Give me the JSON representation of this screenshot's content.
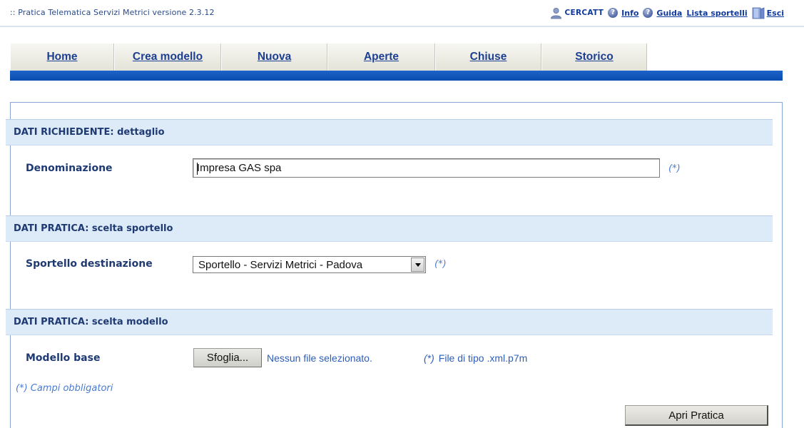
{
  "app": {
    "title": ":: Pratica Telematica Servizi Metrici versione 2.3.12"
  },
  "top_links": {
    "user": "CERCATT",
    "info": "Info",
    "guide": "Guida",
    "offices": "Lista sportelli",
    "exit": "Esci"
  },
  "tabs": [
    {
      "label": "Home"
    },
    {
      "label": "Crea modello"
    },
    {
      "label": "Nuova"
    },
    {
      "label": "Aperte"
    },
    {
      "label": "Chiuse"
    },
    {
      "label": "Storico"
    }
  ],
  "sections": {
    "requester": {
      "header": "DATI RICHIEDENTE: dettaglio",
      "field_label": "Denominazione",
      "field_value": "Impresa GAS spa",
      "required_mark": "(*)"
    },
    "office": {
      "header": "DATI PRATICA: scelta sportello",
      "field_label": "Sportello destinazione",
      "selected": "Sportello - Servizi Metrici - Padova",
      "required_mark": "(*)"
    },
    "model": {
      "header": "DATI PRATICA: scelta modello",
      "field_label": "Modello base",
      "browse_label": "Sfoglia...",
      "file_status": "Nessun file selezionato.",
      "required_mark": "(*)",
      "file_type_hint": "File di tipo .xml.p7m"
    }
  },
  "footer": {
    "mandatory_note": "(*) Campi obbligatori",
    "submit_label": "Apri Pratica"
  },
  "colors": {
    "accent_band": "#0a4db0",
    "section_header_bg": "#ddeaf8",
    "label_text": "#1f3a73",
    "required_text": "#4a7bd0"
  },
  "icons": {
    "user": "user-icon",
    "info": "help-icon",
    "guide": "help-icon",
    "exit": "exit-door-icon"
  }
}
